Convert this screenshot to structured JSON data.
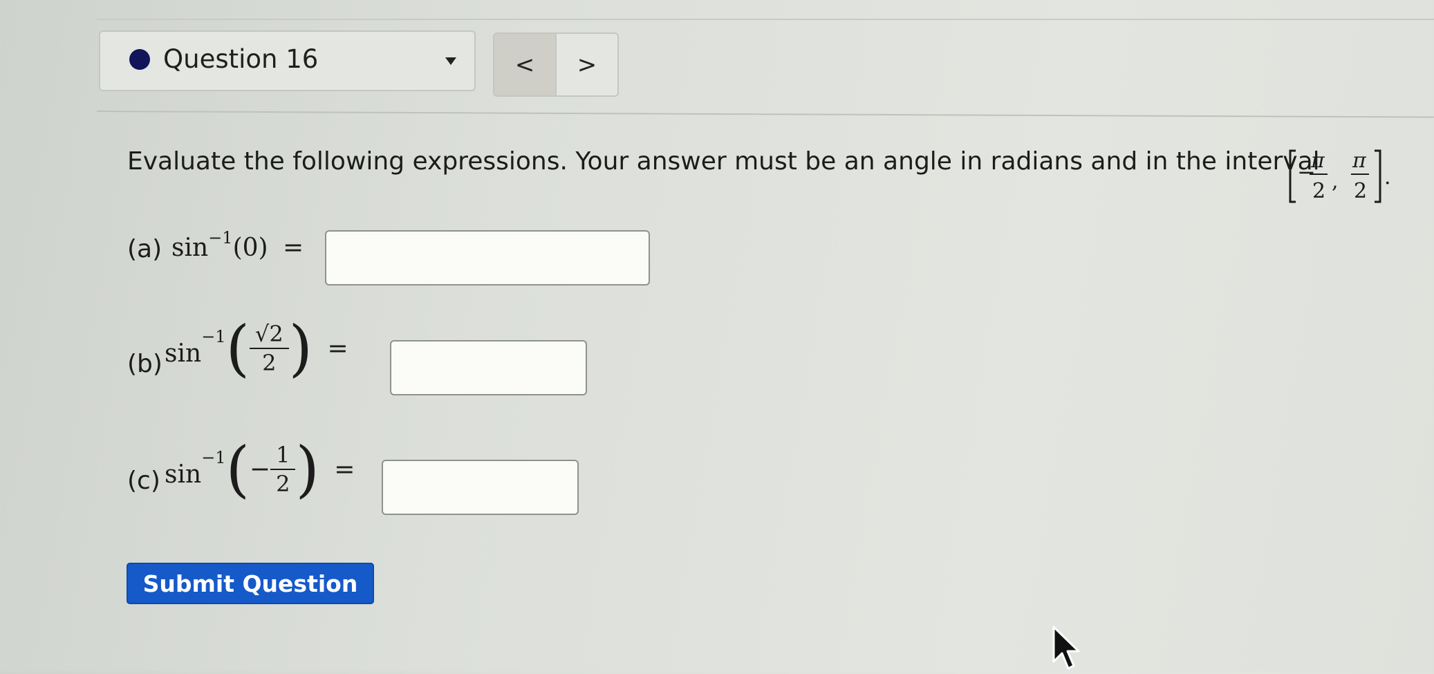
{
  "header": {
    "question_label": "Question 16",
    "prev_label": "<",
    "next_label": ">"
  },
  "prompt": {
    "text": "Evaluate the following expressions. Your answer must be an angle in radians and in the interval",
    "interval": {
      "pi": "π",
      "two": "2",
      "minus": "−",
      "comma": ","
    }
  },
  "parts": [
    {
      "label": "(a)",
      "func": "sin",
      "exp": "−1",
      "arg": "(0)",
      "equals": "=",
      "value": ""
    },
    {
      "label": "(b)",
      "func": "sin",
      "exp": "−1",
      "num": "√2",
      "den": "2",
      "equals": "=",
      "value": ""
    },
    {
      "label": "(c)",
      "func": "sin",
      "exp": "−1",
      "sign": "−",
      "num": "1",
      "den": "2",
      "equals": "=",
      "value": ""
    }
  ],
  "submit_label": "Submit Question",
  "colors": {
    "accent": "#1659c9",
    "dot": "#12155a",
    "background": "#dcdfda"
  }
}
